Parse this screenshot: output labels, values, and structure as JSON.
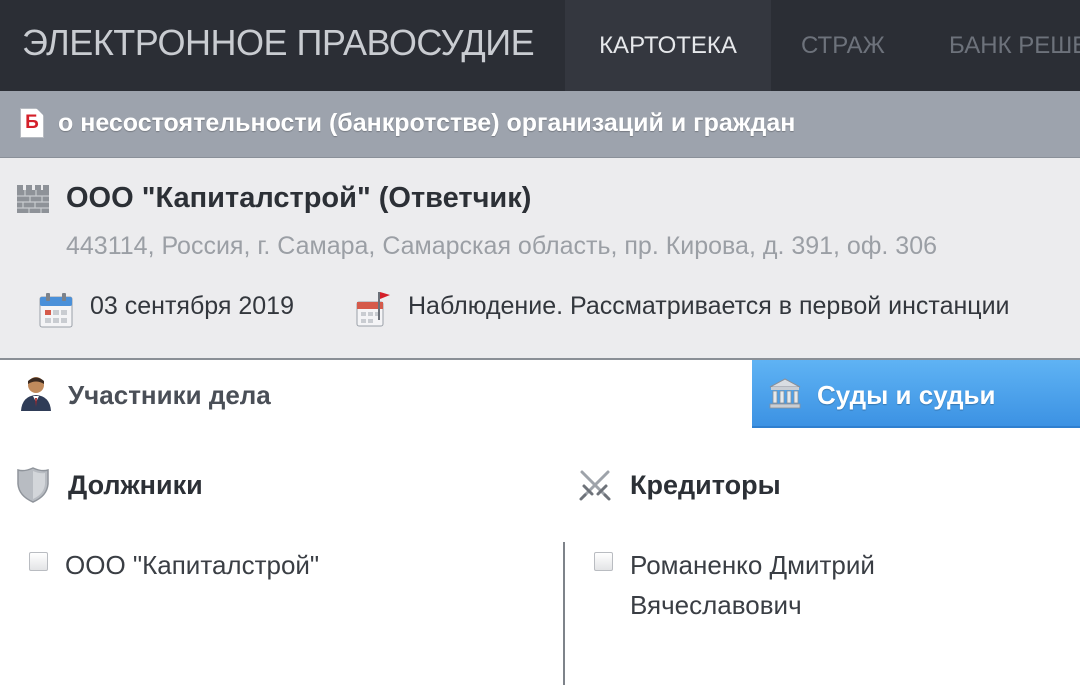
{
  "nav": {
    "brand": "ЭЛЕКТРОННОЕ ПРАВОСУДИЕ",
    "tabs": [
      {
        "label": "КАРТОТЕКА",
        "active": true
      },
      {
        "label": "СТРАЖ",
        "active": false
      },
      {
        "label": "БАНК РЕШЕ",
        "active": false
      }
    ]
  },
  "category": {
    "icon_letter": "Б",
    "text": "о несостоятельности (банкротстве) организаций и граждан"
  },
  "case": {
    "party_title": "ООО \"Капиталстрой\" (Ответчик)",
    "address": "443114, Россия, г. Самара, Самарская область, пр. Кирова, д. 391, оф. 306",
    "date": "03 сентября 2019",
    "stage": "Наблюдение. Рассматривается в первой инстанции"
  },
  "section_tabs": {
    "participants": "Участники дела",
    "courts": "Суды и судьи"
  },
  "parties": {
    "debtors_title": "Должники",
    "debtors": [
      "ООО \"Капиталстрой\""
    ],
    "creditors_title": "Кредиторы",
    "creditors": [
      "Романенко Дмитрий Вячеславович"
    ]
  },
  "colors": {
    "topbar": "#2b2e35",
    "category_bar": "#9da3ad",
    "active_tab_blue": "#4aa0ea",
    "category_icon_red": "#d4202a"
  },
  "icons": {
    "category": "document-b-icon",
    "party": "fortress-wall-icon",
    "date": "calendar-icon",
    "stage": "calendar-flag-icon",
    "participants": "person-icon",
    "courts": "courthouse-icon",
    "debtors": "shield-icon",
    "creditors": "crossed-swords-icon",
    "entry": "checkbox-icon"
  }
}
